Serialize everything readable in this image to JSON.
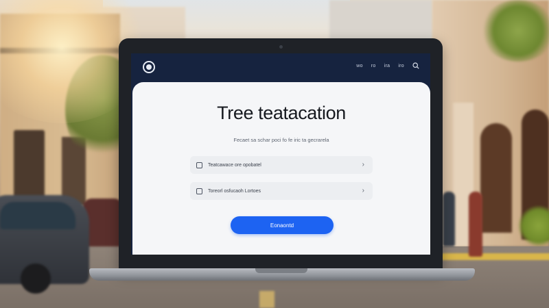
{
  "app": {
    "logo_icon": "app-logo-icon",
    "nav": [
      "wo",
      "ro",
      "ira",
      "iro"
    ],
    "search_icon": "search-icon"
  },
  "main": {
    "title": "Tree teatacation",
    "subtitle": "Fecaet sa schar poci fo fe iric ta gecrarela",
    "options": [
      {
        "icon": "clipboard-icon",
        "label": "Teatcawace ore opobatel",
        "chevron_icon": "chevron-right-icon"
      },
      {
        "icon": "calendar-icon",
        "label": "Toreorl osfucaoh Lortoes",
        "chevron_icon": "chevron-right-icon"
      }
    ],
    "cta_label": "Eonaontd"
  },
  "colors": {
    "navbar": "#16233f",
    "card_bg": "#f5f6f8",
    "accent": "#1d63f2",
    "option_bg": "#eceef1"
  }
}
